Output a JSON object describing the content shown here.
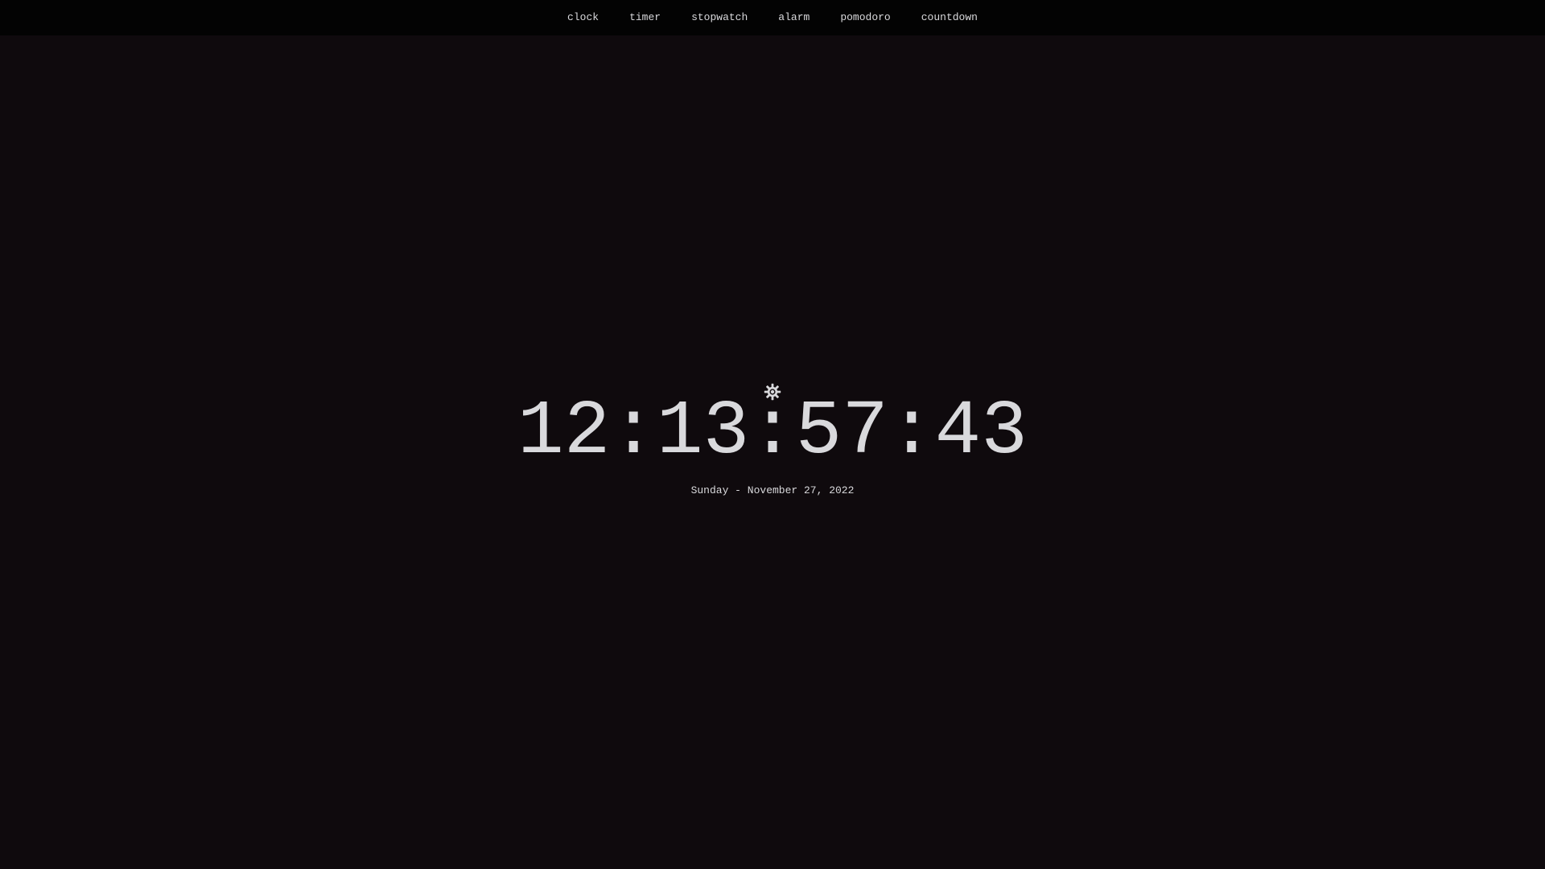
{
  "nav": {
    "items": [
      {
        "label": "clock"
      },
      {
        "label": "timer"
      },
      {
        "label": "stopwatch"
      },
      {
        "label": "alarm"
      },
      {
        "label": "pomodoro"
      },
      {
        "label": "countdown"
      }
    ]
  },
  "clock": {
    "time": "12:13:57:43",
    "date": "Sunday - November 27, 2022",
    "settings_icon": "gear-icon"
  },
  "colors": {
    "background": "#0f0a0d",
    "topbar": "#030303",
    "text": "#d9d9dc"
  }
}
